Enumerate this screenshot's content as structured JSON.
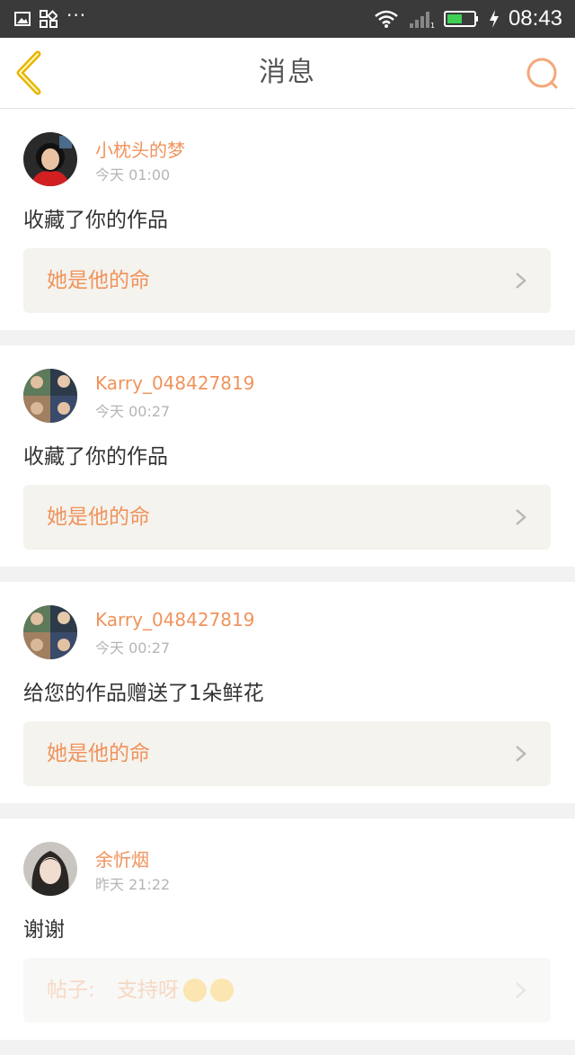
{
  "status_bar": {
    "time": "08:43",
    "more": "···",
    "icons": [
      "gallery-icon",
      "app-grid-icon",
      "wifi-icon",
      "signal-icon",
      "battery-icon",
      "charging-icon"
    ]
  },
  "header": {
    "title": "消息",
    "back_icon": "chevron-left-icon",
    "search_icon": "search-icon"
  },
  "colors": {
    "accent": "#f0935c",
    "back_icon": "#e8b400",
    "search_icon": "#f4a77a",
    "card_bg": "#ffffff",
    "work_bg": "#f4f3ee",
    "page_bg": "#f2f2f2"
  },
  "messages": [
    {
      "user": "小枕头的梦",
      "time": "今天  01:00",
      "action": "收藏了你的作品",
      "work_title": "她是他的命"
    },
    {
      "user": "Karry_048427819",
      "time": "今天  00:27",
      "action": "收藏了你的作品",
      "work_title": "她是他的命"
    },
    {
      "user": "Karry_048427819",
      "time": "今天  00:27",
      "action": "给您的作品赠送了1朵鲜花",
      "work_title": "她是他的命"
    },
    {
      "user": "余忻烟",
      "time": "昨天  21:22",
      "action": "谢谢",
      "work_label": "帖子:",
      "work_title": "支持呀"
    }
  ]
}
